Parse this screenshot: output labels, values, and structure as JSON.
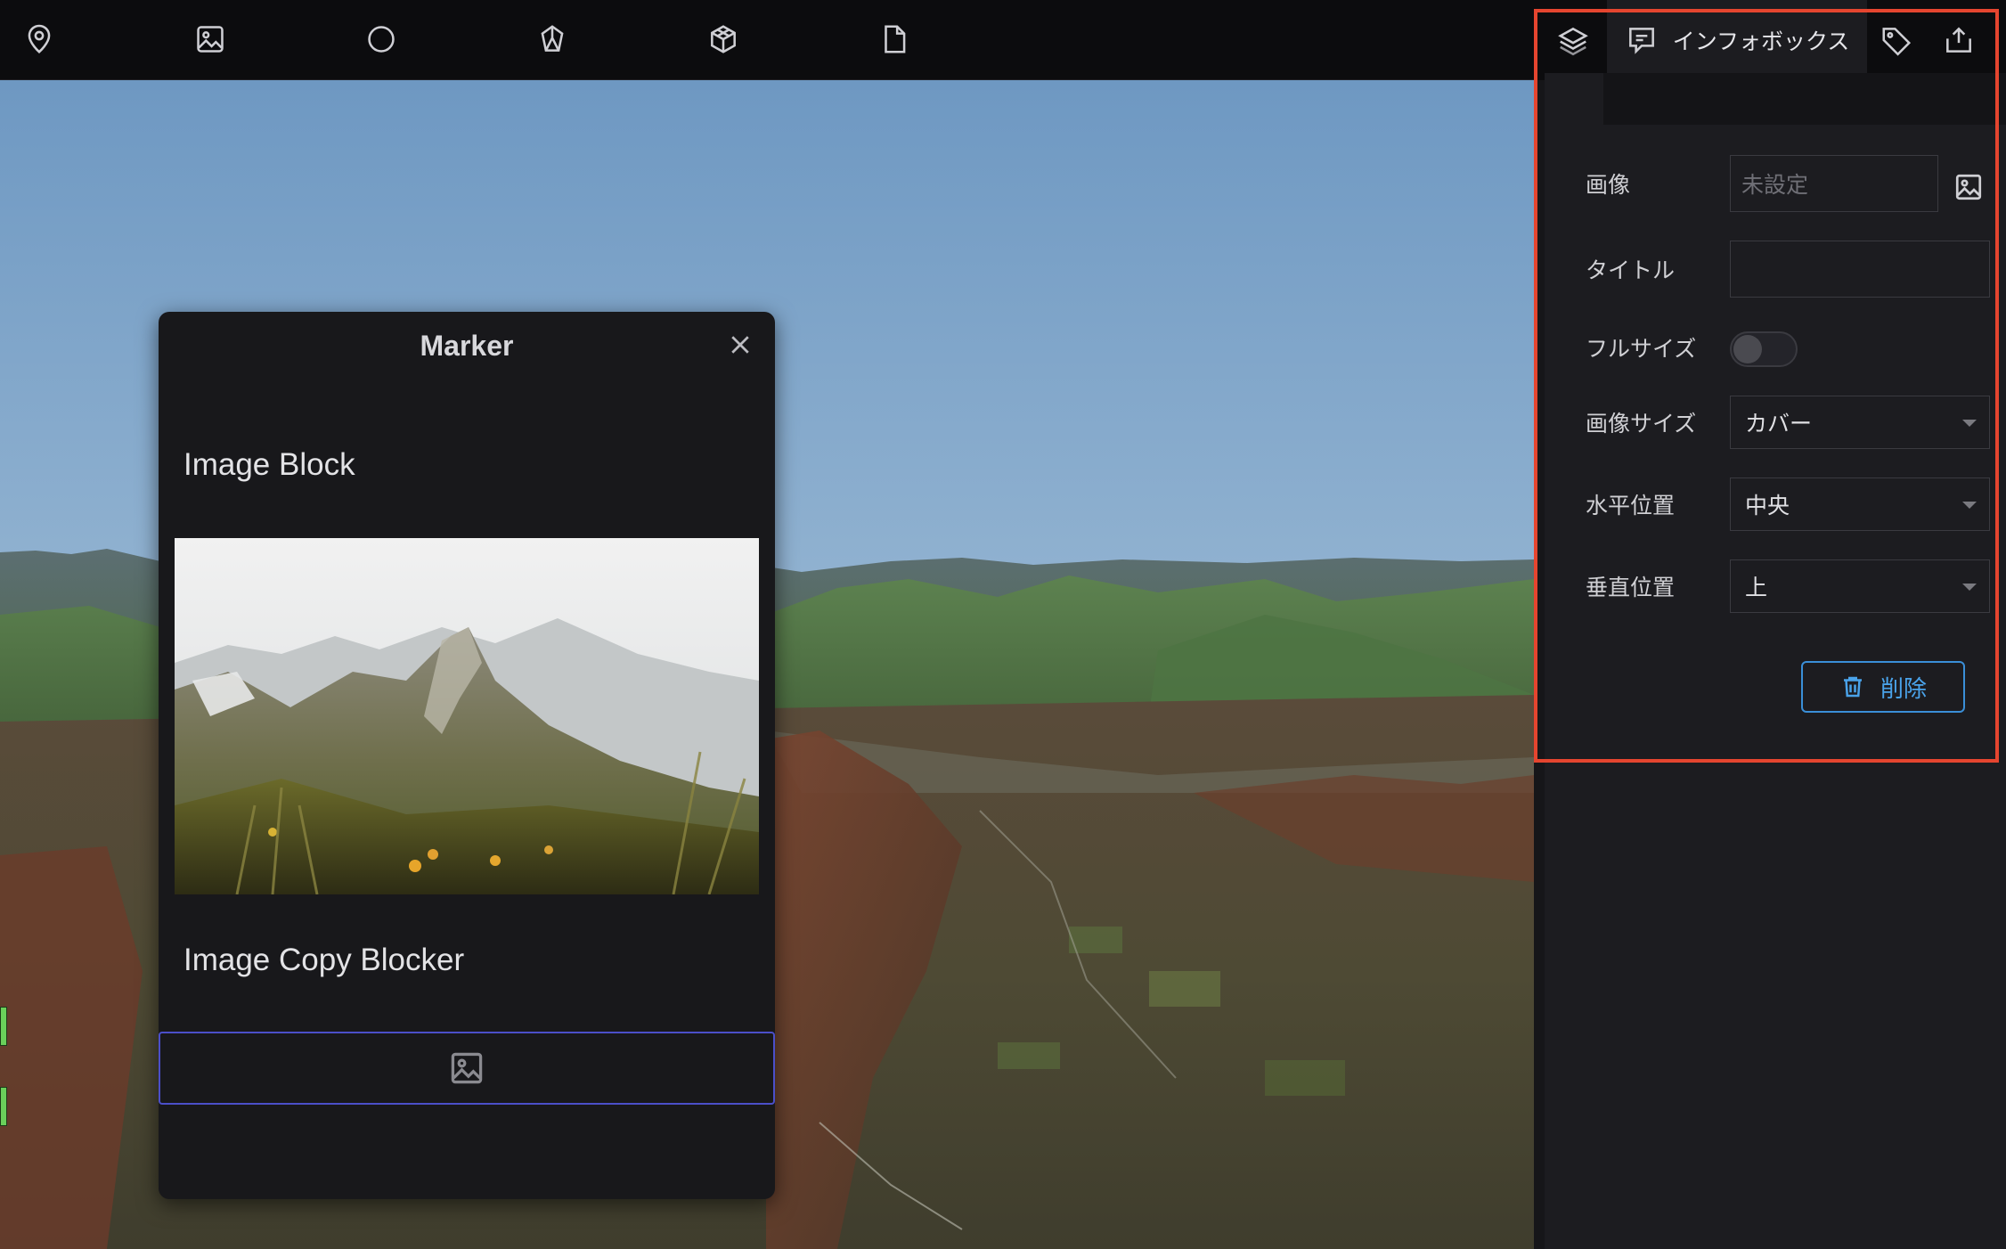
{
  "toolbar": {
    "tools": [
      {
        "icon": "map-pin-icon"
      },
      {
        "icon": "image-icon"
      },
      {
        "icon": "circle-icon"
      },
      {
        "icon": "polygon-icon"
      },
      {
        "icon": "model-icon"
      },
      {
        "icon": "file-icon"
      }
    ]
  },
  "marker_card": {
    "title": "Marker",
    "blocks": [
      {
        "heading": "Image Block"
      },
      {
        "heading": "Image Copy Blocker"
      }
    ]
  },
  "right_panel": {
    "tabs": [
      {
        "icon": "layers-icon"
      },
      {
        "icon": "infobox-icon",
        "label": "インフォボックス",
        "active": true
      },
      {
        "icon": "tag-icon"
      },
      {
        "icon": "export-icon"
      }
    ],
    "fields": {
      "image": {
        "label": "画像",
        "placeholder": "未設定"
      },
      "title": {
        "label": "タイトル",
        "value": ""
      },
      "full_size": {
        "label": "フルサイズ",
        "on": false
      },
      "image_size": {
        "label": "画像サイズ",
        "value": "カバー"
      },
      "horizontal_position": {
        "label": "水平位置",
        "value": "中央"
      },
      "vertical_position": {
        "label": "垂直位置",
        "value": "上"
      }
    },
    "delete_label": "削除"
  },
  "colors": {
    "accent_blue": "#3a8fd8",
    "highlight_red": "#e5452f",
    "placeholder_border": "#4b4fc9"
  }
}
